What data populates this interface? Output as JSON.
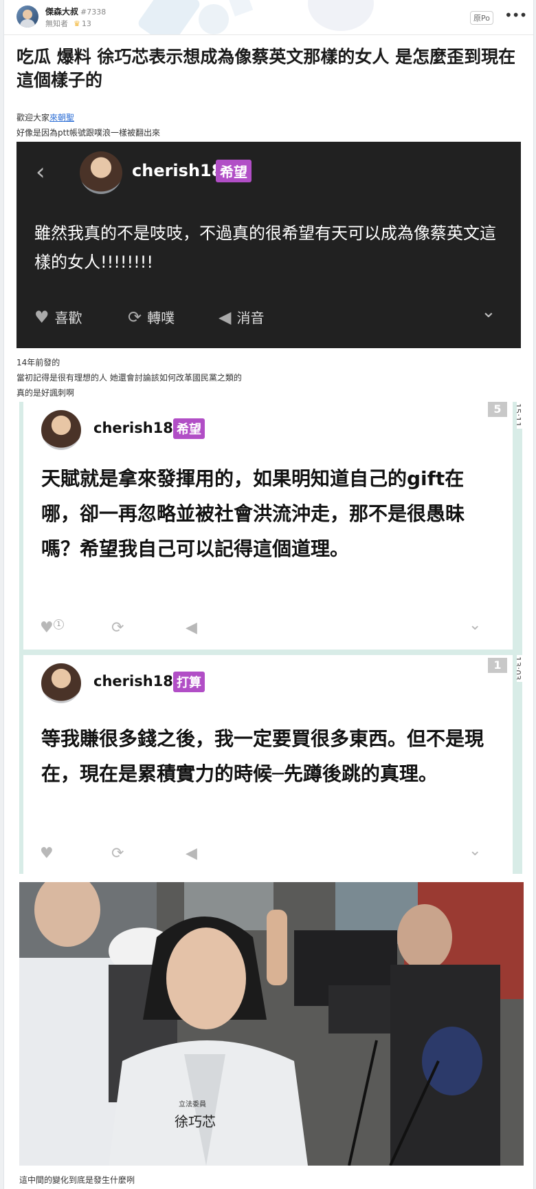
{
  "header": {
    "username": "傑森大叔",
    "user_id": "#7338",
    "sub_label": "無知者",
    "crown_count": "13",
    "op_badge": "原Po"
  },
  "post": {
    "title": "吃瓜 爆料 徐巧芯表示想成為像蔡英文那樣的女人 是怎麼歪到現在這個樣子的",
    "intro_prefix": "歡迎大家",
    "intro_link": "來朝聖",
    "line2": "好像是因為ptt帳號跟噗浪一樣被翻出來",
    "mid_lines": [
      "14年前發的",
      "當初記得是很有理想的人 她還會討論該如何改革國民黨之類的",
      "真的是好諷刺啊"
    ],
    "caption": "這中間的變化到底是發生什麼咧"
  },
  "plurk1": {
    "username": "cherish18",
    "tag": "希望",
    "message": "雖然我真的不是吱吱，不過真的很希望有天可以成為像蔡英文這樣的女人!!!!!!!!",
    "like": "喜歡",
    "replurk": "轉噗",
    "mute": "消音"
  },
  "plurk2": {
    "username": "cherish18",
    "tag": "希望",
    "number": "5",
    "time": "15:11",
    "message": "天賦就是拿來發揮用的，如果明知道自己的gift在哪，卻一再忽略並被社會洪流沖走，那不是很愚昧嗎？希望我自己可以記得這個道理。",
    "like_count": "1"
  },
  "plurk3": {
    "username": "cherish18",
    "tag": "打算",
    "number": "1",
    "time": "13:03",
    "message": "等我賺很多錢之後，我一定要買很多東西。但不是現在，現在是累積實力的時候─先蹲後跳的真理。"
  },
  "photo": {
    "sash_title": "立法委員",
    "sash_name": "徐巧芯"
  },
  "colors": {
    "tag_purple": "#b14ec6",
    "dark_bg": "#212121",
    "strip": "#d8ece7",
    "link": "#2c6ed5"
  }
}
